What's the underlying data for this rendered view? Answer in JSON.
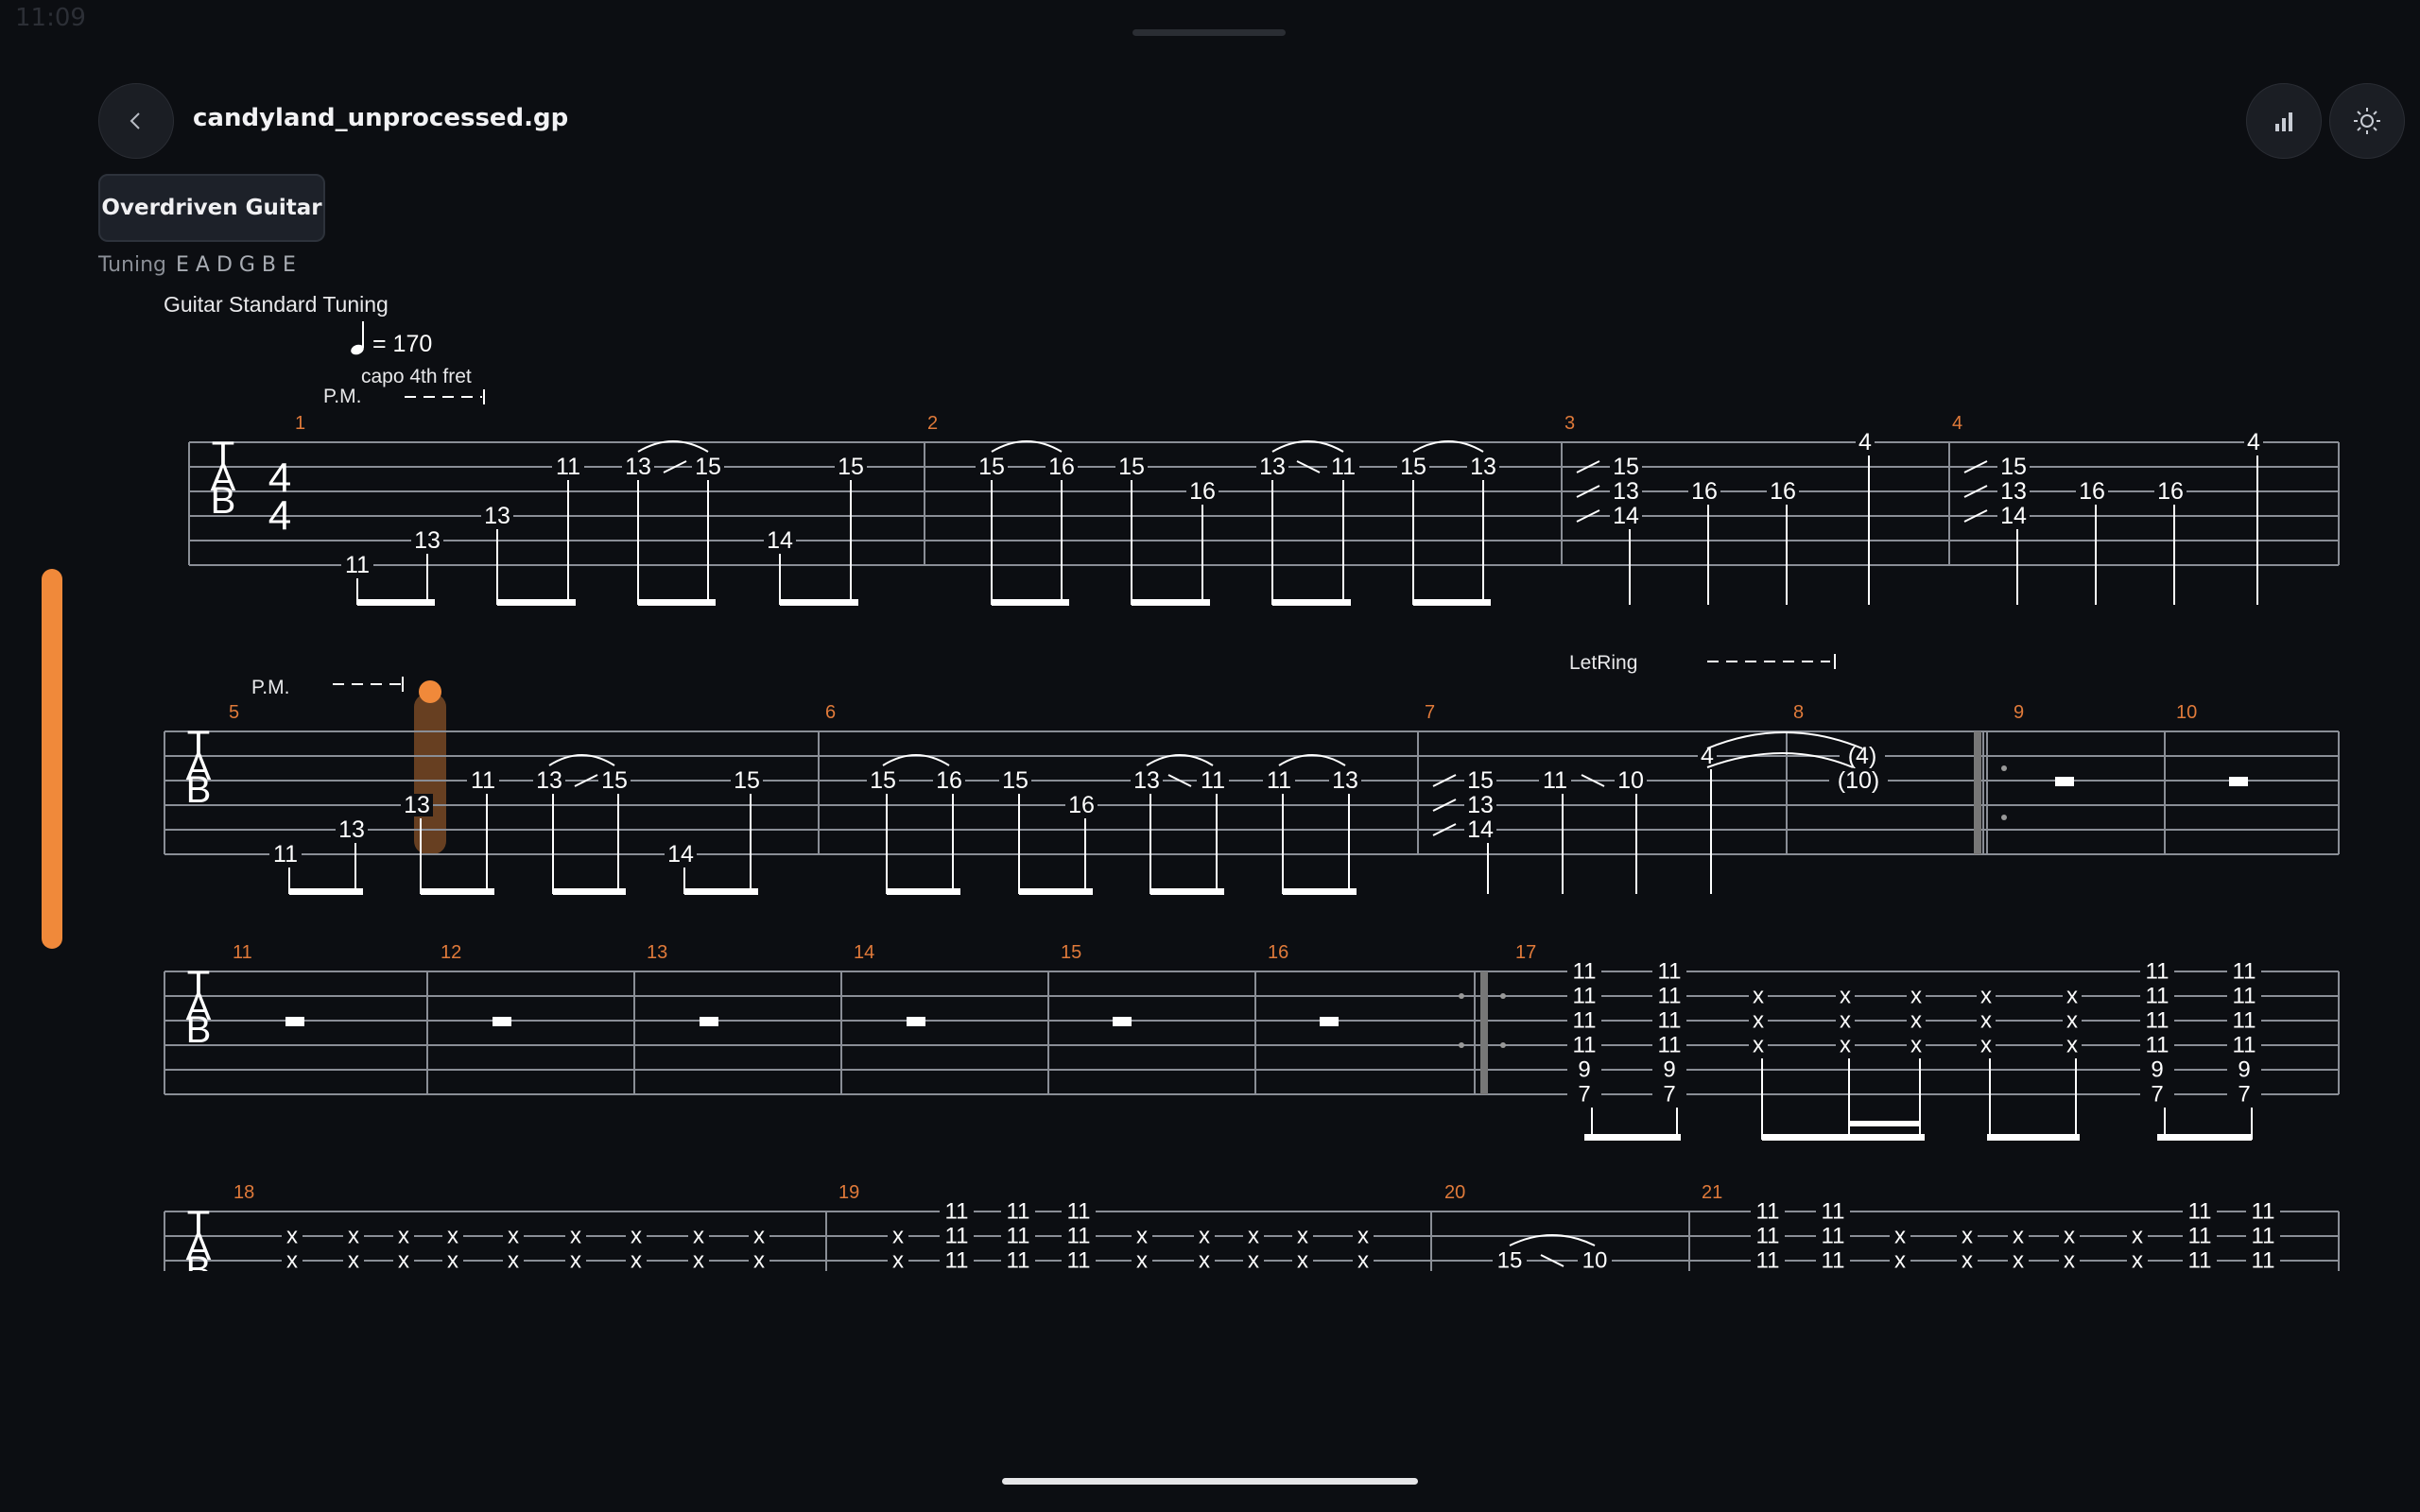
{
  "status": {
    "time": "11:09"
  },
  "header": {
    "back_icon": "chevron-left-icon",
    "title": "candyland_unprocessed.gp",
    "stats_icon": "bar-chart-icon",
    "theme_icon": "sun-icon"
  },
  "track": {
    "name": "Overdriven Guitar"
  },
  "tuning": {
    "label": "Tuning",
    "notes": "E A D G B E"
  },
  "score": {
    "tuning_name": "Guitar Standard Tuning",
    "tempo": "= 170",
    "capo": "capo 4th fret",
    "pm": "P.M.",
    "let_ring": "LetRing",
    "tab_letters": [
      "T",
      "A",
      "B"
    ],
    "time_sig": "4",
    "bar_numbers": [
      "1",
      "2",
      "3",
      "4",
      "5",
      "6",
      "7",
      "8",
      "9",
      "10",
      "11",
      "12",
      "13",
      "14",
      "15",
      "16",
      "17",
      "18",
      "19",
      "20",
      "21"
    ]
  },
  "colors": {
    "accent": "#f0893a",
    "bg": "#0c0e12",
    "staff": "#8a8e96",
    "text": "#ffffff",
    "bar_number": "#e07a3a"
  }
}
